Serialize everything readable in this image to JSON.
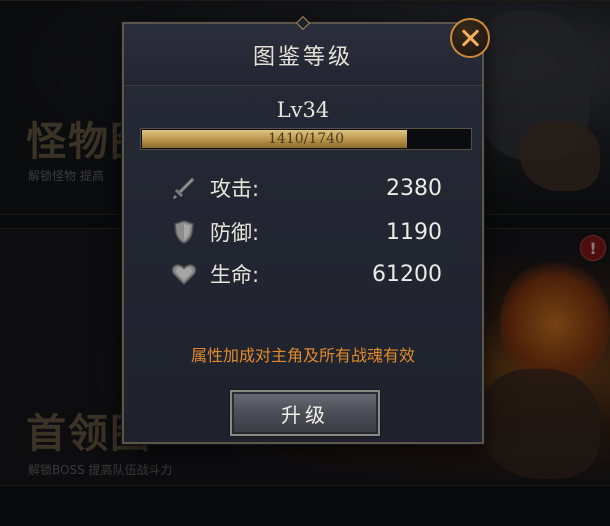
{
  "background": {
    "monster_card": {
      "title": "怪物图",
      "subtitle": "解锁怪物 提高"
    },
    "boss_card": {
      "title": "首领图",
      "subtitle": "解锁BOSS 提高队伍战斗力"
    },
    "alert_badge": "!"
  },
  "dialog": {
    "title": "图鉴等级",
    "level": "Lv34",
    "exp": {
      "current": 1410,
      "max": 1740,
      "text": "1410/1740"
    },
    "stats": [
      {
        "icon": "sword-icon",
        "label": "攻击:",
        "value": "2380"
      },
      {
        "icon": "shield-icon",
        "label": "防御:",
        "value": "1190"
      },
      {
        "icon": "heart-icon",
        "label": "生命:",
        "value": "61200"
      }
    ],
    "note": "属性加成对主角及所有战魂有效",
    "upgrade_button": "升级",
    "close_icon": "close-icon"
  },
  "colors": {
    "accent_gold": "#c98a3b",
    "note_orange": "#e08a2b",
    "exp_fill": "#c8a55c"
  }
}
